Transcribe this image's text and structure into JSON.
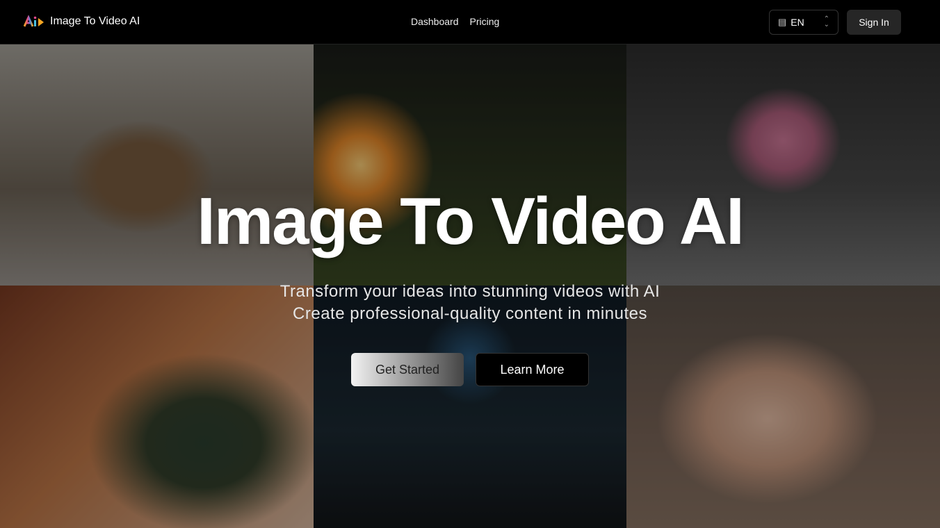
{
  "nav": {
    "brand": "Image To Video AI",
    "links": [
      "Dashboard",
      "Pricing"
    ],
    "language": "EN",
    "sign_in": "Sign In"
  },
  "hero": {
    "title": "Image To Video AI",
    "subtitle_lines": [
      "Transform your ideas into stunning videos with AI",
      "Create professional-quality content in minutes"
    ],
    "get_started": "Get Started",
    "learn_more": "Learn More"
  }
}
